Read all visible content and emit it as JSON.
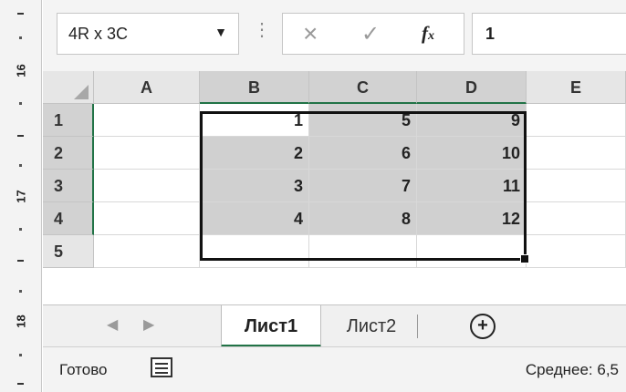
{
  "ruler": {
    "labels": [
      "16",
      "17",
      "18"
    ]
  },
  "formula_bar": {
    "name_box": "4R x 3C",
    "dropdown_icon": "caret-down-icon",
    "cancel_icon": "close-icon",
    "enter_icon": "check-icon",
    "fx_label": "f",
    "fx_sub": "x",
    "formula_value": "1"
  },
  "grid": {
    "columns": [
      "A",
      "B",
      "C",
      "D",
      "E"
    ],
    "rows": [
      "1",
      "2",
      "3",
      "4",
      "5"
    ],
    "cells": [
      [
        "",
        "1",
        "5",
        "9",
        ""
      ],
      [
        "",
        "2",
        "6",
        "10",
        ""
      ],
      [
        "",
        "3",
        "7",
        "11",
        ""
      ],
      [
        "",
        "4",
        "8",
        "12",
        ""
      ],
      [
        "",
        "",
        "",
        "",
        ""
      ]
    ],
    "selection_range": "B1:D4"
  },
  "sheets": {
    "tabs": [
      "Лист1",
      "Лист2"
    ],
    "active_index": 0,
    "add_icon": "plus-circle-icon"
  },
  "status": {
    "ready": "Готово",
    "macro_icon": "macro-record-icon",
    "average": "Среднее: 6,5"
  },
  "colors": {
    "accent": "#217346",
    "selection": "#d0d0d0"
  }
}
